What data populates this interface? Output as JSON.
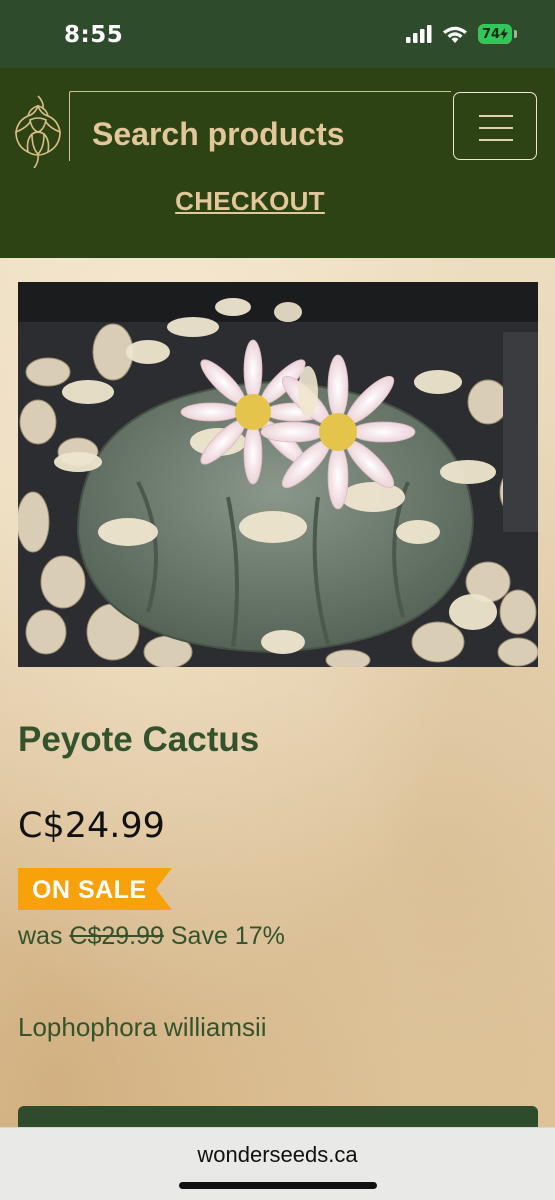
{
  "status_bar": {
    "time": "8:55",
    "battery": "74",
    "icons": [
      "cellular-signal-icon",
      "wifi-icon",
      "battery-charging-icon"
    ]
  },
  "header": {
    "search_placeholder": "Search products",
    "checkout_label": "CHECKOUT",
    "logo_icon": "artichoke-logo-icon",
    "menu_icon": "hamburger-menu-icon"
  },
  "product": {
    "image_alt": "Peyote cactus with pink-white flowers in gravel",
    "title": "Peyote Cactus",
    "price": "C$24.99",
    "sale_badge": "ON SALE",
    "was_prefix": "was ",
    "old_price": "C$29.99",
    "save_text": " Save 17%",
    "scientific_name": "Lophophora williamsii"
  },
  "browser": {
    "url": "wonderseeds.ca"
  },
  "colors": {
    "header_green": "#2d4313",
    "status_green": "#2e4b2c",
    "accent_tan": "#e2c79a",
    "text_green": "#34532d",
    "sale_orange": "#f7a10b",
    "battery_green": "#33c759"
  }
}
